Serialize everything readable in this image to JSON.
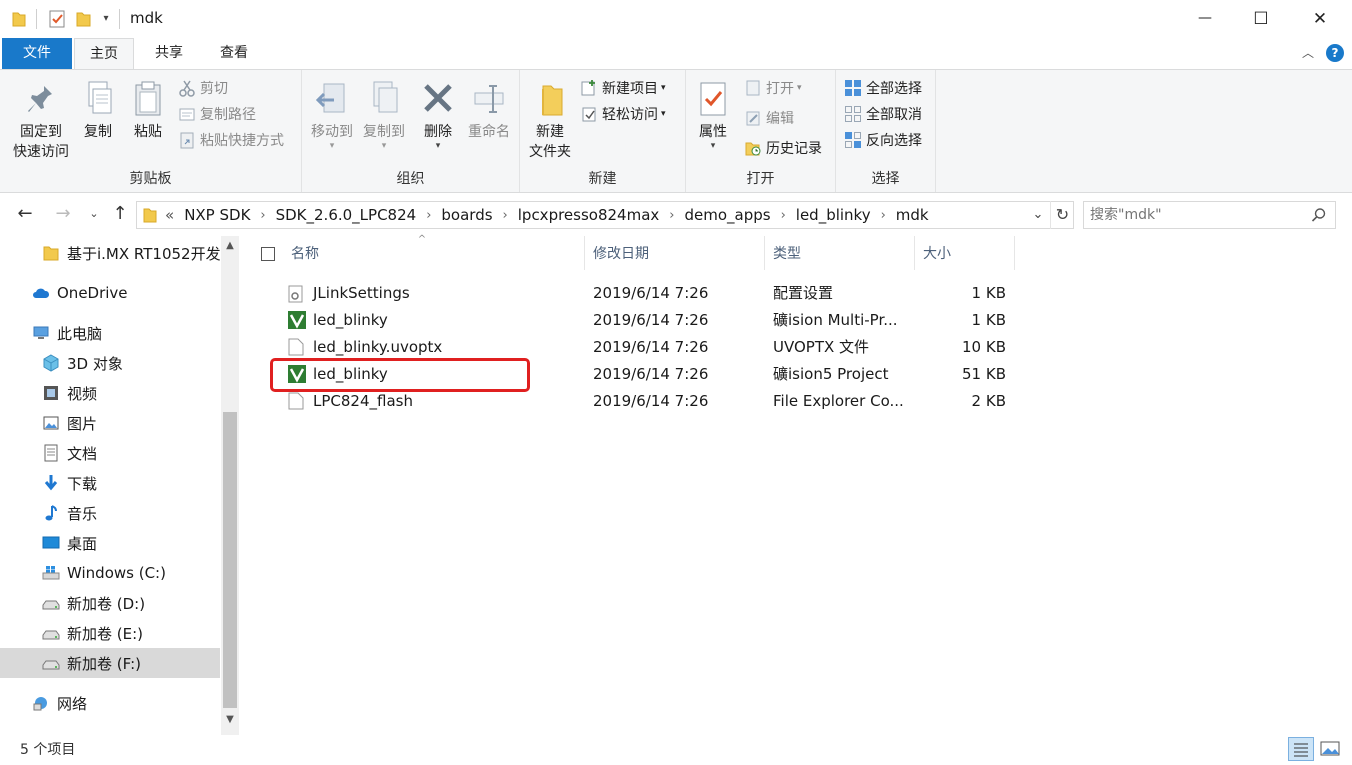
{
  "window": {
    "title": "mdk",
    "controls": {
      "minimize": "—",
      "maximize": "☐",
      "close": "✕"
    }
  },
  "ribbon_tabs": [
    {
      "label": "文件"
    },
    {
      "label": "主页"
    },
    {
      "label": "共享"
    },
    {
      "label": "查看"
    }
  ],
  "ribbon": {
    "clipboard": {
      "label": "剪贴板",
      "pin_line1": "固定到",
      "pin_line2": "快速访问",
      "copy": "复制",
      "paste": "粘贴",
      "cut": "剪切",
      "copy_path": "复制路径",
      "paste_shortcut": "粘贴快捷方式"
    },
    "organize": {
      "label": "组织",
      "move_to": "移动到",
      "copy_to": "复制到",
      "delete": "删除",
      "rename": "重命名"
    },
    "new": {
      "label": "新建",
      "new_folder_line1": "新建",
      "new_folder_line2": "文件夹",
      "new_item": "新建项目",
      "easy_access": "轻松访问"
    },
    "open": {
      "label": "打开",
      "properties": "属性",
      "open": "打开",
      "edit": "编辑",
      "history": "历史记录"
    },
    "select": {
      "label": "选择",
      "select_all": "全部选择",
      "select_none": "全部取消",
      "invert": "反向选择"
    }
  },
  "address": {
    "overflow": "«",
    "crumbs": [
      "NXP SDK",
      "SDK_2.6.0_LPC824",
      "boards",
      "lpcxpresso824max",
      "demo_apps",
      "led_blinky",
      "mdk"
    ],
    "search_placeholder": "搜索\"mdk\""
  },
  "nav": {
    "items": [
      {
        "label": "基于i.MX RT1052开发"
      },
      {
        "label": "OneDrive"
      },
      {
        "label": "此电脑"
      },
      {
        "label": "3D 对象"
      },
      {
        "label": "视频"
      },
      {
        "label": "图片"
      },
      {
        "label": "文档"
      },
      {
        "label": "下载"
      },
      {
        "label": "音乐"
      },
      {
        "label": "桌面"
      },
      {
        "label": "Windows (C:)"
      },
      {
        "label": "新加卷 (D:)"
      },
      {
        "label": "新加卷 (E:)"
      },
      {
        "label": "新加卷 (F:)"
      },
      {
        "label": "网络"
      }
    ]
  },
  "columns": {
    "name": "名称",
    "date": "修改日期",
    "type": "类型",
    "size": "大小"
  },
  "files": [
    {
      "name": "JLinkSettings",
      "date": "2019/6/14 7:26",
      "type": "配置设置",
      "size": "1 KB",
      "icon": "settings-file-icon"
    },
    {
      "name": "led_blinky",
      "date": "2019/6/14 7:26",
      "type": "礦ision Multi-Pr...",
      "size": "1 KB",
      "icon": "uvision-icon"
    },
    {
      "name": "led_blinky.uvoptx",
      "date": "2019/6/14 7:26",
      "type": "UVOPTX 文件",
      "size": "10 KB",
      "icon": "blank-file-icon"
    },
    {
      "name": "led_blinky",
      "date": "2019/6/14 7:26",
      "type": "礦ision5 Project",
      "size": "51 KB",
      "icon": "uvision-icon"
    },
    {
      "name": "LPC824_flash",
      "date": "2019/6/14 7:26",
      "type": "File Explorer Co...",
      "size": "2 KB",
      "icon": "blank-file-icon"
    }
  ],
  "status": {
    "count": "5 个项目"
  },
  "colors": {
    "accent": "#1979ca",
    "highlight": "#e02020",
    "selected_nav": "#d9d9d9"
  }
}
